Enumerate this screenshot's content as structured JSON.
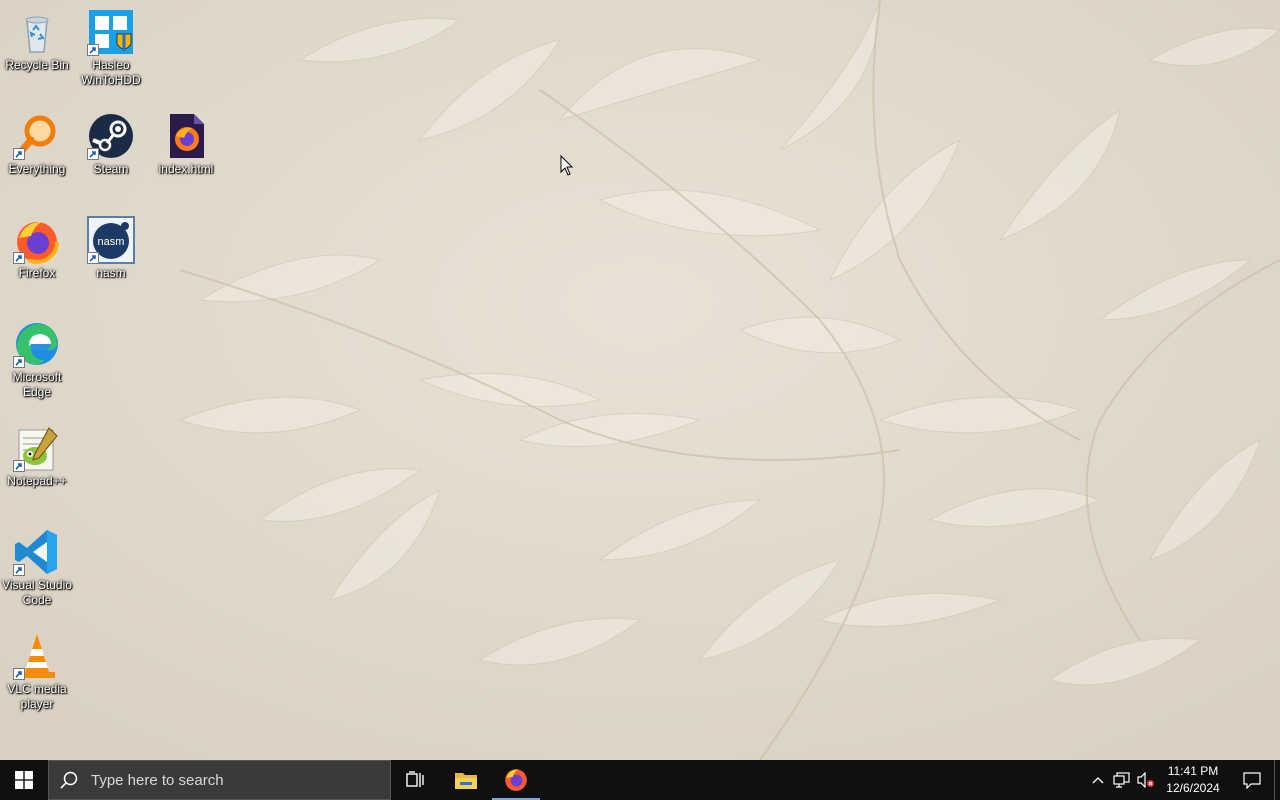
{
  "desktop_icons": [
    {
      "label": "Recycle Bin",
      "icon": "recycle-bin-icon"
    },
    {
      "label": "Hasleo WinToHDD",
      "icon": "hasleo-wintohdd-icon"
    },
    {
      "label": "Everything",
      "icon": "everything-search-icon"
    },
    {
      "label": "Steam",
      "icon": "steam-icon"
    },
    {
      "label": "index.html",
      "icon": "firefox-html-file-icon"
    },
    {
      "label": "Firefox",
      "icon": "firefox-icon"
    },
    {
      "label": "nasm",
      "icon": "nasm-icon"
    },
    {
      "label": "Microsoft Edge",
      "icon": "edge-icon"
    },
    {
      "label": "Notepad++",
      "icon": "notepadpp-icon"
    },
    {
      "label": "Visual Studio Code",
      "icon": "vscode-icon"
    },
    {
      "label": "VLC media player",
      "icon": "vlc-icon"
    }
  ],
  "taskbar": {
    "search_placeholder": "Type here to search",
    "pinned": [
      "start-icon",
      "task-view-icon",
      "file-explorer-icon",
      "firefox-icon"
    ],
    "accent": "#101010"
  },
  "tray": {
    "time": "11:41 PM",
    "date": "12/6/2024",
    "icons": [
      "chevron-up-icon",
      "network-icon",
      "volume-muted-icon",
      "notification-icon"
    ]
  }
}
